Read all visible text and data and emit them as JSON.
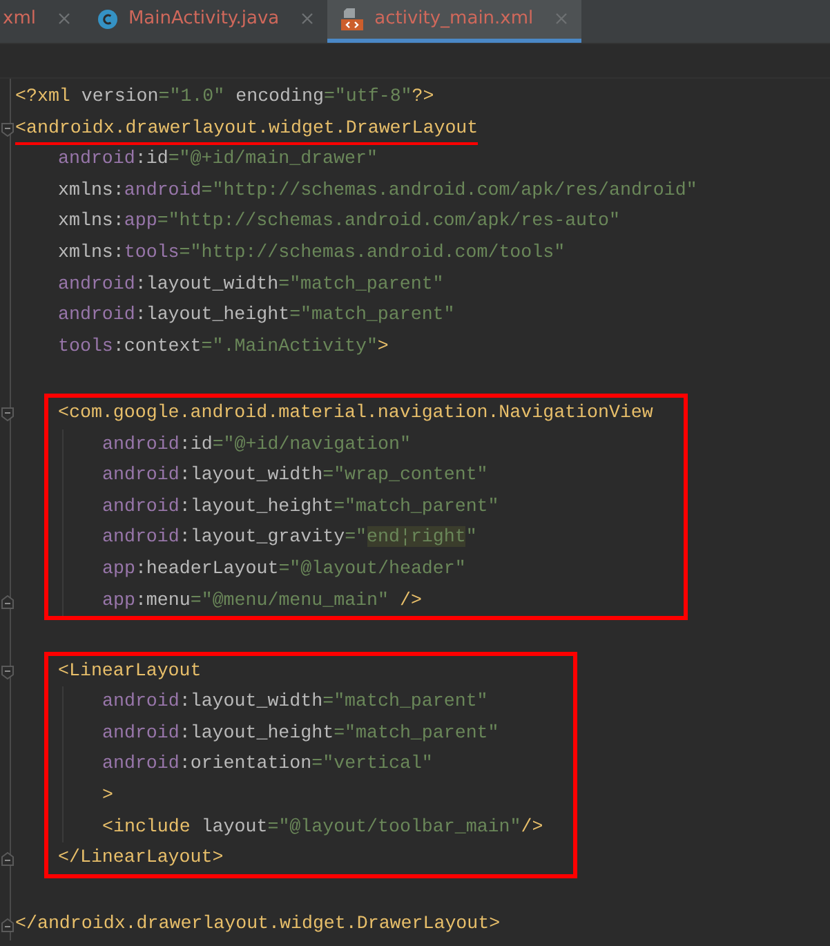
{
  "tabs": [
    {
      "label": "xml",
      "selected": false
    },
    {
      "label": "MainActivity.java",
      "selected": false
    },
    {
      "label": "activity_main.xml",
      "selected": true
    }
  ],
  "code": [
    {
      "kind": "line",
      "tokens": [
        {
          "kind": "tag",
          "text": "<?xml "
        },
        {
          "kind": "attr",
          "text": "version"
        },
        {
          "kind": "value",
          "text": "=\"1.0\" "
        },
        {
          "kind": "attr",
          "text": "encoding"
        },
        {
          "kind": "value",
          "text": "=\"utf-8\""
        },
        {
          "kind": "tag",
          "text": "?>"
        }
      ]
    },
    {
      "kind": "fold-start",
      "underlined": true,
      "tokens": [
        {
          "kind": "tag",
          "text": "<androidx.drawerlayout.widget.DrawerLayout"
        }
      ],
      "children": [
        {
          "kind": "line",
          "tokens": [
            {
              "kind": "ns",
              "text": "android"
            },
            {
              "kind": "attr",
              "text": ":id"
            },
            {
              "kind": "value",
              "text": "=\"@+id/main_drawer\""
            }
          ]
        },
        {
          "kind": "line",
          "tokens": [
            {
              "kind": "attr",
              "text": "xmlns:"
            },
            {
              "kind": "ns",
              "text": "android"
            },
            {
              "kind": "value",
              "text": "=\"http://schemas.android.com/apk/res/android\""
            }
          ]
        },
        {
          "kind": "line",
          "tokens": [
            {
              "kind": "attr",
              "text": "xmlns:"
            },
            {
              "kind": "ns",
              "text": "app"
            },
            {
              "kind": "value",
              "text": "=\"http://schemas.android.com/apk/res-auto\""
            }
          ]
        },
        {
          "kind": "line",
          "tokens": [
            {
              "kind": "attr",
              "text": "xmlns:"
            },
            {
              "kind": "ns",
              "text": "tools"
            },
            {
              "kind": "value",
              "text": "=\"http://schemas.android.com/tools\""
            }
          ]
        },
        {
          "kind": "line",
          "tokens": [
            {
              "kind": "ns",
              "text": "android"
            },
            {
              "kind": "attr",
              "text": ":layout_width"
            },
            {
              "kind": "value",
              "text": "=\"match_parent\""
            }
          ]
        },
        {
          "kind": "line",
          "tokens": [
            {
              "kind": "ns",
              "text": "android"
            },
            {
              "kind": "attr",
              "text": ":layout_height"
            },
            {
              "kind": "value",
              "text": "=\"match_parent\""
            }
          ]
        },
        {
          "kind": "line",
          "tokens": [
            {
              "kind": "ns",
              "text": "tools"
            },
            {
              "kind": "attr",
              "text": ":context"
            },
            {
              "kind": "value",
              "text": "=\".MainActivity\""
            },
            {
              "kind": "tag",
              "text": ">"
            }
          ]
        },
        {
          "kind": "blank"
        },
        {
          "kind": "box",
          "children": [
            {
              "kind": "fold-start",
              "tokens": [
                {
                  "kind": "tag",
                  "text": "<com.google.android.material.navigation.NavigationView"
                }
              ],
              "children": [
                {
                  "kind": "line",
                  "tokens": [
                    {
                      "kind": "ns",
                      "text": "android"
                    },
                    {
                      "kind": "attr",
                      "text": ":id"
                    },
                    {
                      "kind": "value",
                      "text": "=\"@+id/navigation\""
                    }
                  ]
                },
                {
                  "kind": "line",
                  "tokens": [
                    {
                      "kind": "ns",
                      "text": "android"
                    },
                    {
                      "kind": "attr",
                      "text": ":layout_width"
                    },
                    {
                      "kind": "value",
                      "text": "=\"wrap_content\""
                    }
                  ]
                },
                {
                  "kind": "line",
                  "tokens": [
                    {
                      "kind": "ns",
                      "text": "android"
                    },
                    {
                      "kind": "attr",
                      "text": ":layout_height"
                    },
                    {
                      "kind": "value",
                      "text": "=\"match_parent\""
                    }
                  ]
                },
                {
                  "kind": "line",
                  "tokens": [
                    {
                      "kind": "ns",
                      "text": "android"
                    },
                    {
                      "kind": "attr",
                      "text": ":layout_gravity"
                    },
                    {
                      "kind": "value",
                      "text": "=\""
                    },
                    {
                      "kind": "highlight",
                      "text": "end¦right"
                    },
                    {
                      "kind": "value",
                      "text": "\""
                    }
                  ]
                },
                {
                  "kind": "line",
                  "tokens": [
                    {
                      "kind": "ns",
                      "text": "app"
                    },
                    {
                      "kind": "attr",
                      "text": ":headerLayout"
                    },
                    {
                      "kind": "value",
                      "text": "=\"@layout/header\""
                    }
                  ]
                },
                {
                  "kind": "fold-end",
                  "tokens": [
                    {
                      "kind": "ns",
                      "text": "app"
                    },
                    {
                      "kind": "attr",
                      "text": ":menu"
                    },
                    {
                      "kind": "value",
                      "text": "=\"@menu/menu_main\" "
                    },
                    {
                      "kind": "tag",
                      "text": "/>"
                    }
                  ]
                }
              ]
            }
          ]
        },
        {
          "kind": "blank"
        },
        {
          "kind": "box",
          "children": [
            {
              "kind": "fold-start",
              "tokens": [
                {
                  "kind": "tag",
                  "text": "<LinearLayout"
                }
              ],
              "children": [
                {
                  "kind": "line",
                  "tokens": [
                    {
                      "kind": "ns",
                      "text": "android"
                    },
                    {
                      "kind": "attr",
                      "text": ":layout_width"
                    },
                    {
                      "kind": "value",
                      "text": "=\"match_parent\""
                    }
                  ]
                },
                {
                  "kind": "line",
                  "tokens": [
                    {
                      "kind": "ns",
                      "text": "android"
                    },
                    {
                      "kind": "attr",
                      "text": ":layout_height"
                    },
                    {
                      "kind": "value",
                      "text": "=\"match_parent\""
                    }
                  ]
                },
                {
                  "kind": "line",
                  "tokens": [
                    {
                      "kind": "ns",
                      "text": "android"
                    },
                    {
                      "kind": "attr",
                      "text": ":orientation"
                    },
                    {
                      "kind": "value",
                      "text": "=\"vertical\""
                    }
                  ]
                },
                {
                  "kind": "line",
                  "tokens": [
                    {
                      "kind": "tag",
                      "text": ">"
                    }
                  ]
                },
                {
                  "kind": "line",
                  "tokens": [
                    {
                      "kind": "tag",
                      "text": "<include "
                    },
                    {
                      "kind": "attr",
                      "text": "layout"
                    },
                    {
                      "kind": "value",
                      "text": "=\"@layout/toolbar_main\""
                    },
                    {
                      "kind": "tag",
                      "text": "/>"
                    }
                  ]
                }
              ]
            },
            {
              "kind": "fold-end",
              "tokens": [
                {
                  "kind": "tag",
                  "text": "</LinearLayout>"
                }
              ]
            }
          ]
        },
        {
          "kind": "blank"
        }
      ]
    },
    {
      "kind": "fold-end",
      "tokens": [
        {
          "kind": "tag",
          "text": "</androidx.drawerlayout.widget.DrawerLayout>"
        }
      ]
    }
  ]
}
